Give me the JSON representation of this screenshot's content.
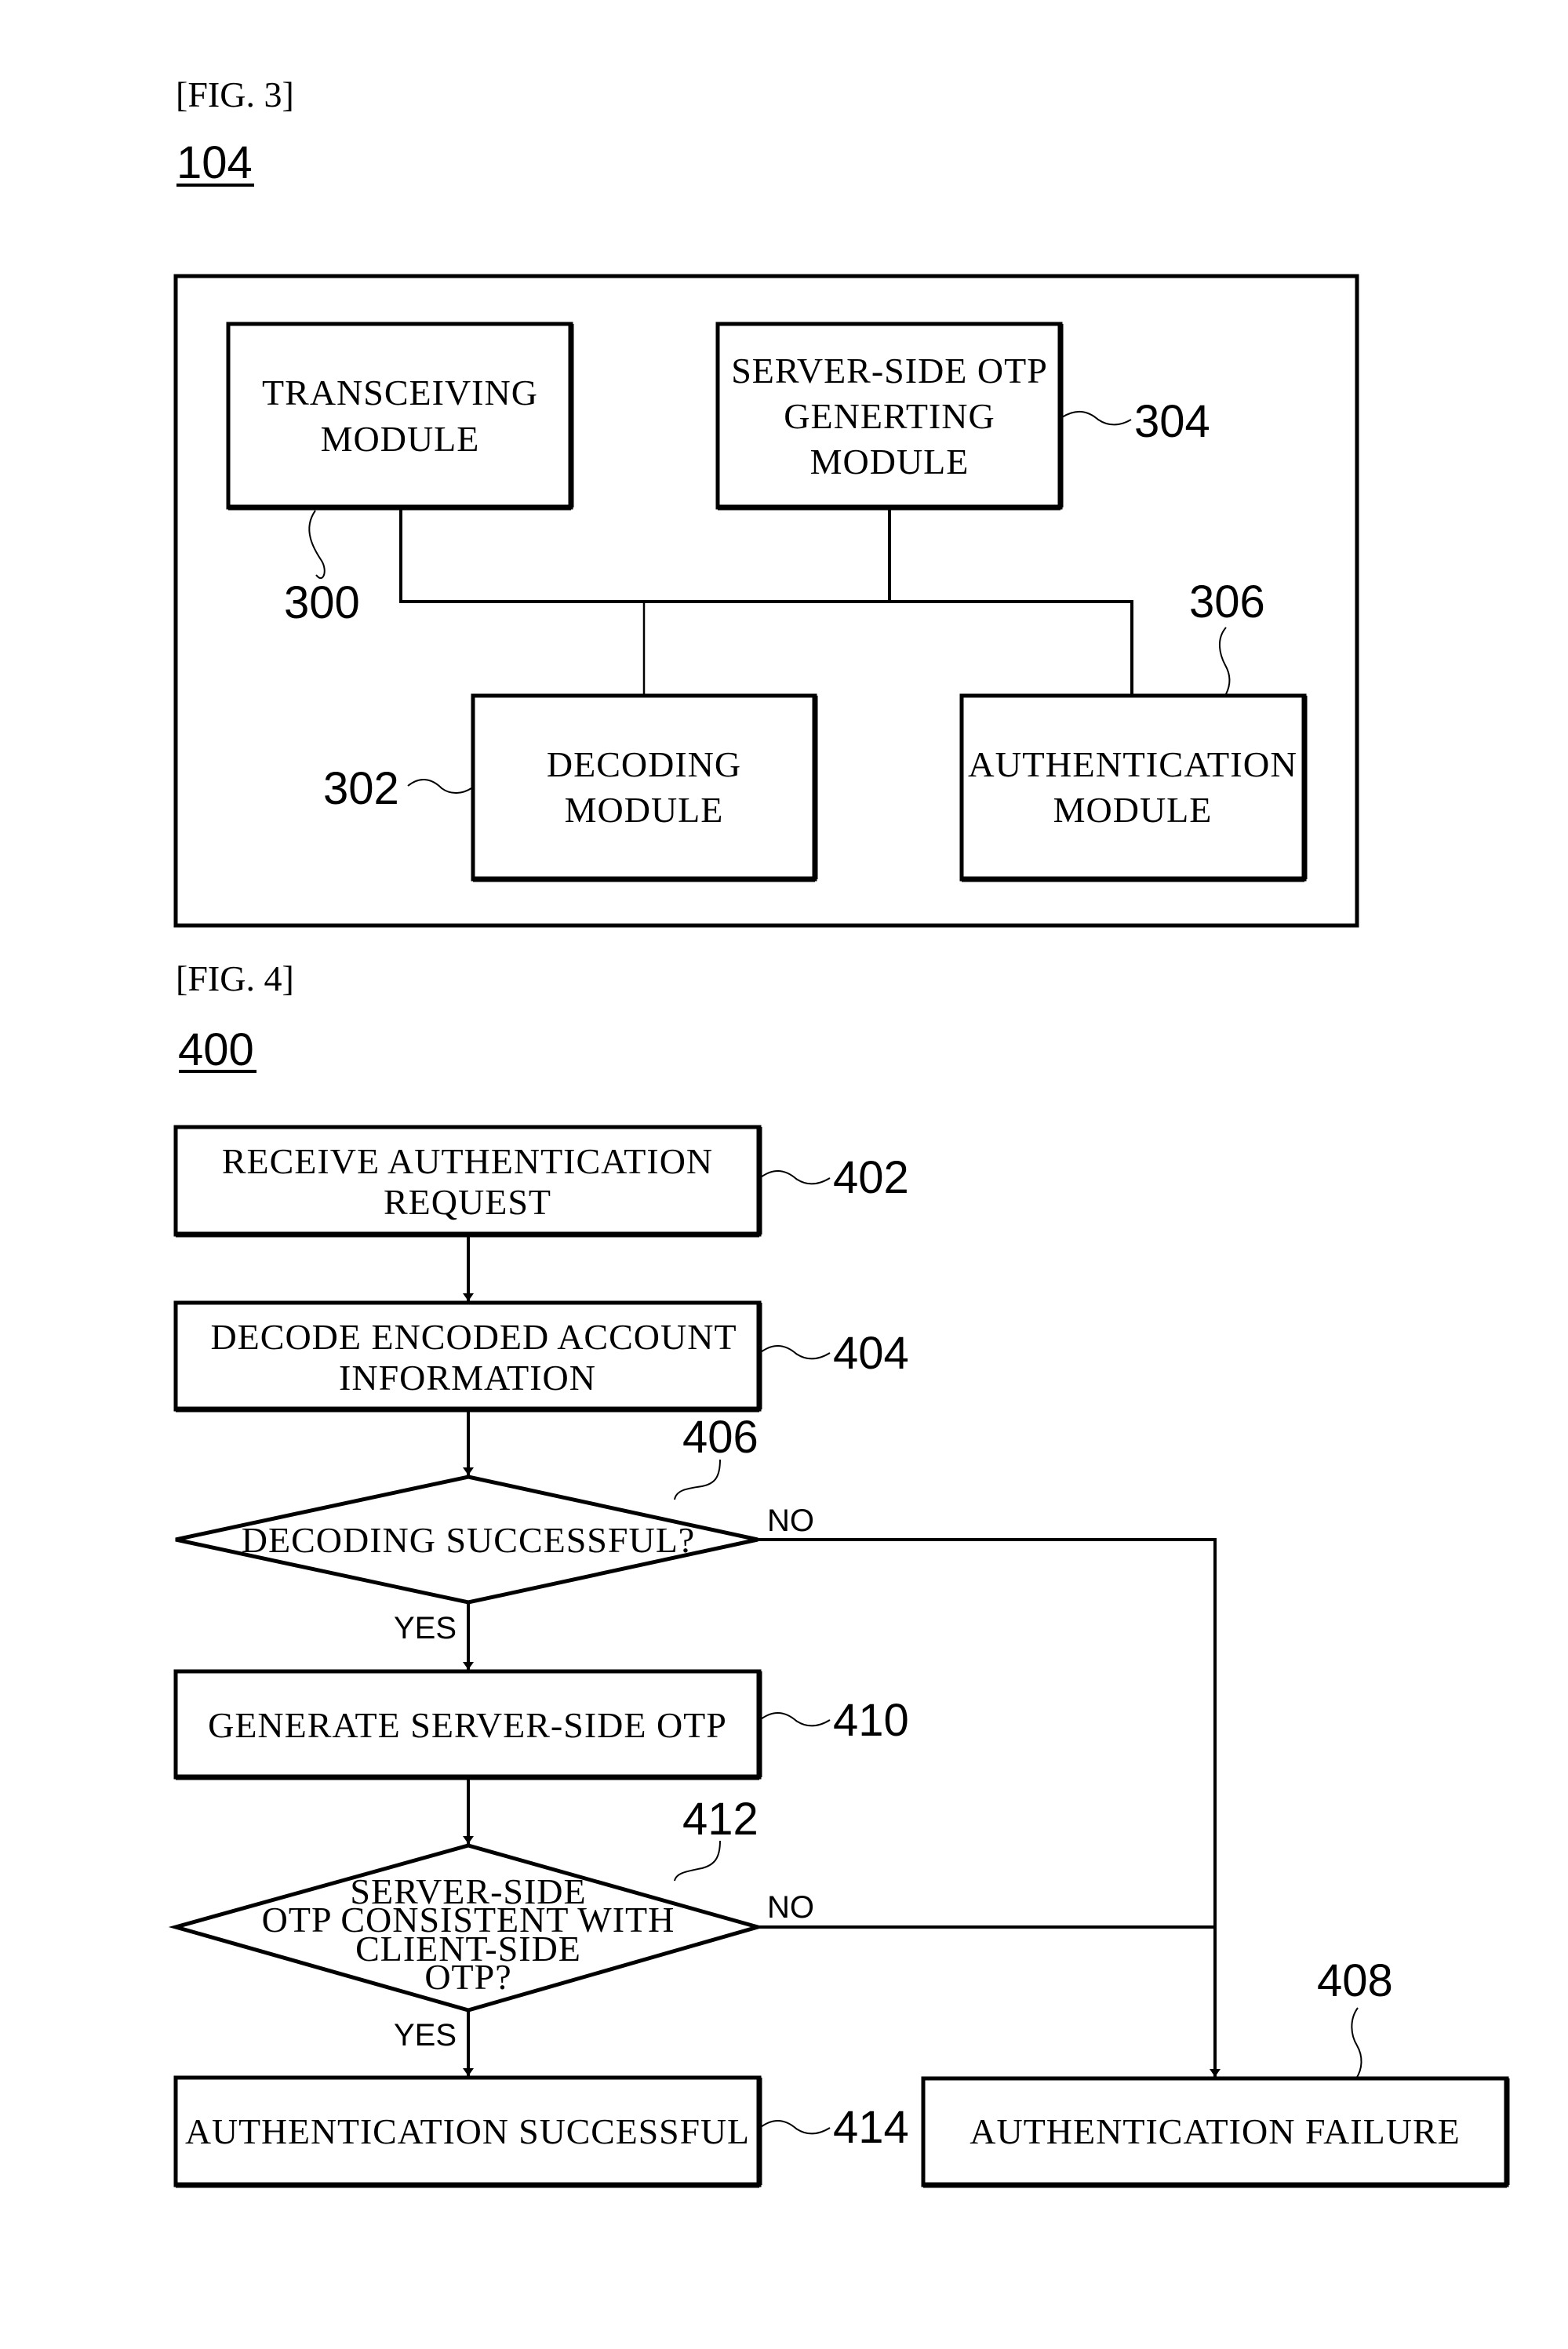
{
  "fig3": {
    "caption": "[FIG. 3]",
    "number": "104",
    "modules": {
      "transceiving": {
        "lines": [
          "TRANSCEIVING",
          "MODULE"
        ],
        "ref": "300"
      },
      "otp_generating": {
        "lines": [
          "SERVER-SIDE OTP",
          "GENERTING",
          "MODULE"
        ],
        "ref": "304"
      },
      "decoding": {
        "lines": [
          "DECODING",
          "MODULE"
        ],
        "ref": "302"
      },
      "authentication": {
        "lines": [
          "AUTHENTICATION",
          "MODULE"
        ],
        "ref": "306"
      }
    }
  },
  "fig4": {
    "caption": "[FIG. 4]",
    "number": "400",
    "steps": {
      "receive": {
        "lines": [
          "RECEIVE AUTHENTICATION",
          "REQUEST"
        ],
        "ref": "402"
      },
      "decode": {
        "lines": [
          "DECODE ENCODED ACCOUNT",
          "INFORMATION"
        ],
        "ref": "404"
      },
      "decision_decoding": {
        "lines": [
          "DECODING SUCCESSFUL?"
        ],
        "ref": "406"
      },
      "generate": {
        "lines": [
          "GENERATE SERVER-SIDE OTP"
        ],
        "ref": "410"
      },
      "decision_otp": {
        "lines": [
          "SERVER-SIDE",
          "OTP CONSISTENT WITH",
          "CLIENT-SIDE",
          "OTP?"
        ],
        "ref": "412"
      },
      "success": {
        "lines": [
          "AUTHENTICATION SUCCESSFUL"
        ],
        "ref": "414"
      },
      "failure": {
        "lines": [
          "AUTHENTICATION FAILURE"
        ],
        "ref": "408"
      }
    },
    "branch_labels": {
      "yes": "YES",
      "no": "NO"
    }
  }
}
